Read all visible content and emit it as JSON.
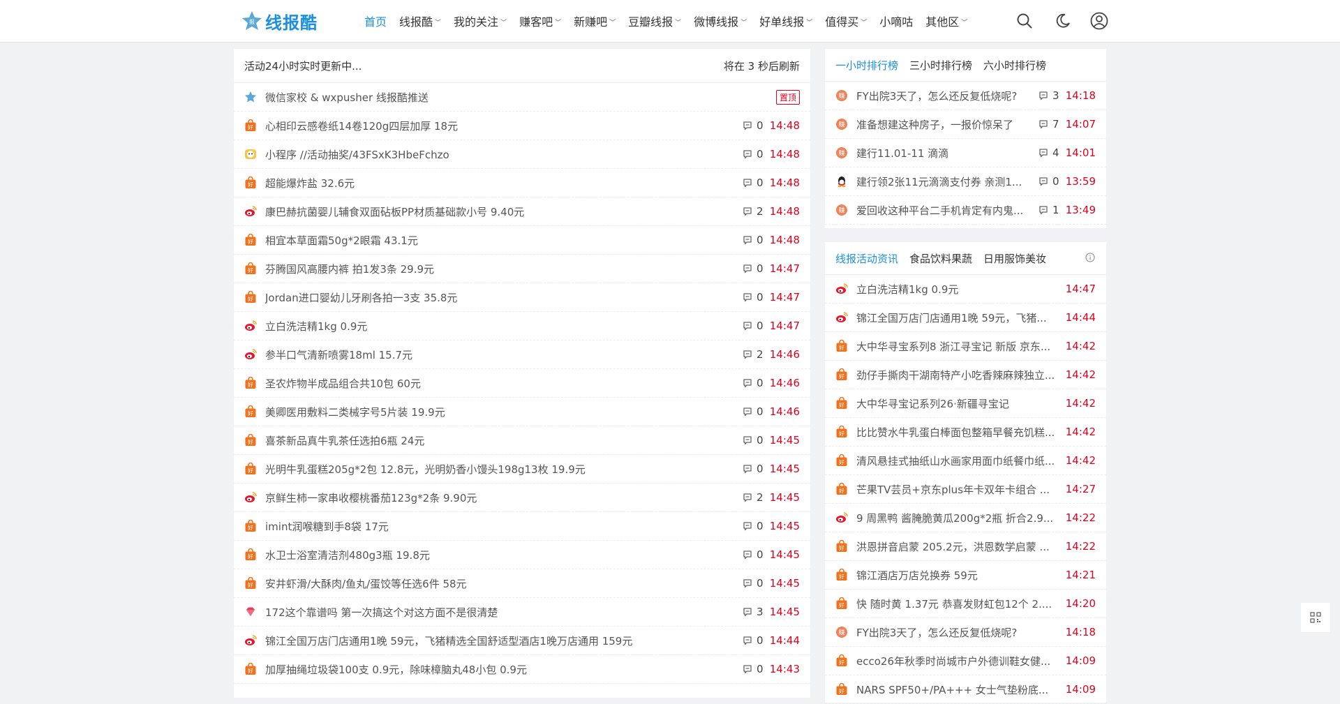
{
  "header": {
    "logo_text": "线报酷",
    "nav": [
      {
        "label": "首页",
        "active": true,
        "dropdown": false
      },
      {
        "label": "线报酷",
        "active": false,
        "dropdown": true
      },
      {
        "label": "我的关注",
        "active": false,
        "dropdown": true
      },
      {
        "label": "赚客吧",
        "active": false,
        "dropdown": true
      },
      {
        "label": "新赚吧",
        "active": false,
        "dropdown": true
      },
      {
        "label": "豆瓣线报",
        "active": false,
        "dropdown": true
      },
      {
        "label": "微博线报",
        "active": false,
        "dropdown": true
      },
      {
        "label": "好单线报",
        "active": false,
        "dropdown": true
      },
      {
        "label": "值得买",
        "active": false,
        "dropdown": true
      },
      {
        "label": "小嘀咕",
        "active": false,
        "dropdown": false
      },
      {
        "label": "其他区",
        "active": false,
        "dropdown": true
      }
    ],
    "icons": [
      "search-icon",
      "moon-icon",
      "user-icon"
    ]
  },
  "main": {
    "status_text": "活动24小时实时更新中...",
    "refresh_text": "将在 3 秒后刷新",
    "pinned": {
      "title": "微信家校 & wxpusher 线报酷推送",
      "badge": "置顶",
      "icon": "logo"
    },
    "items": [
      {
        "icon": "bag",
        "title": "心相印云感卷纸14卷120g四层加厚 18元",
        "comments": "0",
        "time": "14:48"
      },
      {
        "icon": "miniapp",
        "title": "小程序 //活动抽奖/43FSxK3HbeFchzo",
        "comments": "0",
        "time": "14:48"
      },
      {
        "icon": "bag",
        "title": "超能爆炸盐 32.6元",
        "comments": "0",
        "time": "14:48"
      },
      {
        "icon": "weibo",
        "title": "康巴赫抗菌婴儿辅食双面砧板PP材质基础款小号 9.40元",
        "comments": "2",
        "time": "14:48"
      },
      {
        "icon": "bag",
        "title": "相宜本草面霜50g*2眼霜 43.1元",
        "comments": "0",
        "time": "14:48"
      },
      {
        "icon": "bag",
        "title": "芬腾国风高腰内裤 拍1发3条 29.9元",
        "comments": "0",
        "time": "14:47"
      },
      {
        "icon": "bag",
        "title": "Jordan进口婴幼儿牙刷各拍一3支 35.8元",
        "comments": "0",
        "time": "14:47"
      },
      {
        "icon": "weibo",
        "title": "立白洗洁精1kg 0.9元",
        "comments": "0",
        "time": "14:47"
      },
      {
        "icon": "weibo",
        "title": "参半口气清新喷雾18ml 15.7元",
        "comments": "2",
        "time": "14:46"
      },
      {
        "icon": "bag",
        "title": "圣农炸物半成品组合共10包 60元",
        "comments": "0",
        "time": "14:46"
      },
      {
        "icon": "bag",
        "title": "美卿医用敷料二类械字号5片装 19.9元",
        "comments": "0",
        "time": "14:46"
      },
      {
        "icon": "bag",
        "title": "喜茶新品真牛乳茶任选拍6瓶 24元",
        "comments": "0",
        "time": "14:45"
      },
      {
        "icon": "bag",
        "title": "光明牛乳蛋糕205g*2包 12.8元，光明奶香小馒头198g13枚 19.9元",
        "comments": "0",
        "time": "14:45"
      },
      {
        "icon": "weibo",
        "title": "京鲜生柿一家串收樱桃番茄123g*2条 9.90元",
        "comments": "2",
        "time": "14:45"
      },
      {
        "icon": "bag",
        "title": "imint润喉糖到手8袋 17元",
        "comments": "0",
        "time": "14:45"
      },
      {
        "icon": "bag",
        "title": "水卫士浴室清洁剂480g3瓶 19.8元",
        "comments": "0",
        "time": "14:45"
      },
      {
        "icon": "bag",
        "title": "安井虾滑/大酥肉/鱼丸/蛋饺等任选6件 58元",
        "comments": "0",
        "time": "14:45"
      },
      {
        "icon": "gem",
        "title": "172这个靠谱吗 第一次搞这个对这方面不是很清楚",
        "comments": "3",
        "time": "14:45"
      },
      {
        "icon": "weibo",
        "title": "锦江全国万店门店通用1晚 59元，飞猪精选全国舒适型酒店1晚万店通用 159元",
        "comments": "0",
        "time": "14:44"
      },
      {
        "icon": "bag",
        "title": "加厚抽绳垃圾袋100支 0.9元，除味樟脑丸48小包 0.9元",
        "comments": "0",
        "time": "14:43"
      }
    ]
  },
  "ranking": {
    "tabs": [
      {
        "label": "一小时排行榜",
        "active": true
      },
      {
        "label": "三小时排行榜",
        "active": false
      },
      {
        "label": "六小时排行榜",
        "active": false
      }
    ],
    "items": [
      {
        "icon": "zhuan",
        "title": "FY出院3天了，怎么还反复低烧呢?",
        "comments": "3",
        "time": "14:18"
      },
      {
        "icon": "zhuan",
        "title": "准备想建这种房子，一报价惊呆了",
        "comments": "7",
        "time": "14:07"
      },
      {
        "icon": "zhuan",
        "title": "建行11.01-11 滴滴",
        "comments": "4",
        "time": "14:01"
      },
      {
        "icon": "qq",
        "title": "建行领2张11元滴滴支付券 亲测1...",
        "comments": "0",
        "time": "13:59"
      },
      {
        "icon": "zhuan",
        "title": "爱回收这种平台二手机肯定有内鬼...",
        "comments": "1",
        "time": "13:49"
      }
    ]
  },
  "news": {
    "tabs": [
      {
        "label": "线报活动资讯",
        "active": true
      },
      {
        "label": "食品饮料果蔬",
        "active": false
      },
      {
        "label": "日用服饰美妆",
        "active": false
      }
    ],
    "items": [
      {
        "icon": "weibo",
        "title": "立白洗洁精1kg 0.9元",
        "time": "14:47"
      },
      {
        "icon": "weibo",
        "title": "锦江全国万店门店通用1晚 59元，飞猪...",
        "time": "14:44"
      },
      {
        "icon": "bag",
        "title": "大中华寻宝系列8 浙江寻宝记 新版 京东...",
        "time": "14:42"
      },
      {
        "icon": "bag",
        "title": "劲仔手撕肉干湖南特产小吃香辣麻辣独立...",
        "time": "14:42"
      },
      {
        "icon": "bag",
        "title": "大中华寻宝记系列26·新疆寻宝记",
        "time": "14:42"
      },
      {
        "icon": "bag",
        "title": "比比赞水牛乳蛋白棒面包整箱早餐充饥糕...",
        "time": "14:42"
      },
      {
        "icon": "bag",
        "title": "清风悬挂式抽纸山水画家用面巾纸餐巾纸...",
        "time": "14:42"
      },
      {
        "icon": "bag",
        "title": "芒果TV芸员+京东plus年卡双年卡组合 ...",
        "time": "14:27"
      },
      {
        "icon": "weibo",
        "title": "9 周黑鸭 酱腌脆黄瓜200g*2瓶 折合2.9...",
        "time": "14:22"
      },
      {
        "icon": "bag",
        "title": "洪恩拼音启蒙 205.2元，洪恩数学启蒙 ...",
        "time": "14:22"
      },
      {
        "icon": "bag",
        "title": "锦江酒店万店兑换券 59元",
        "time": "14:21"
      },
      {
        "icon": "bag",
        "title": "快 随时黄 1.37元 恭喜发财虹包12个 2....",
        "time": "14:20"
      },
      {
        "icon": "zhuan",
        "title": "FY出院3天了，怎么还反复低烧呢?",
        "time": "14:18"
      },
      {
        "icon": "bag",
        "title": "ecco26年秋季时尚城市户外德训鞋女健...",
        "time": "14:09"
      },
      {
        "icon": "bag",
        "title": "NARS SPF50+/PA+++ 女士气垫粉底...",
        "time": "14:09"
      }
    ]
  },
  "colors": {
    "accent": "#1b8fe0",
    "time_red": "#e0001b",
    "bag_orange": "#f2711c"
  }
}
